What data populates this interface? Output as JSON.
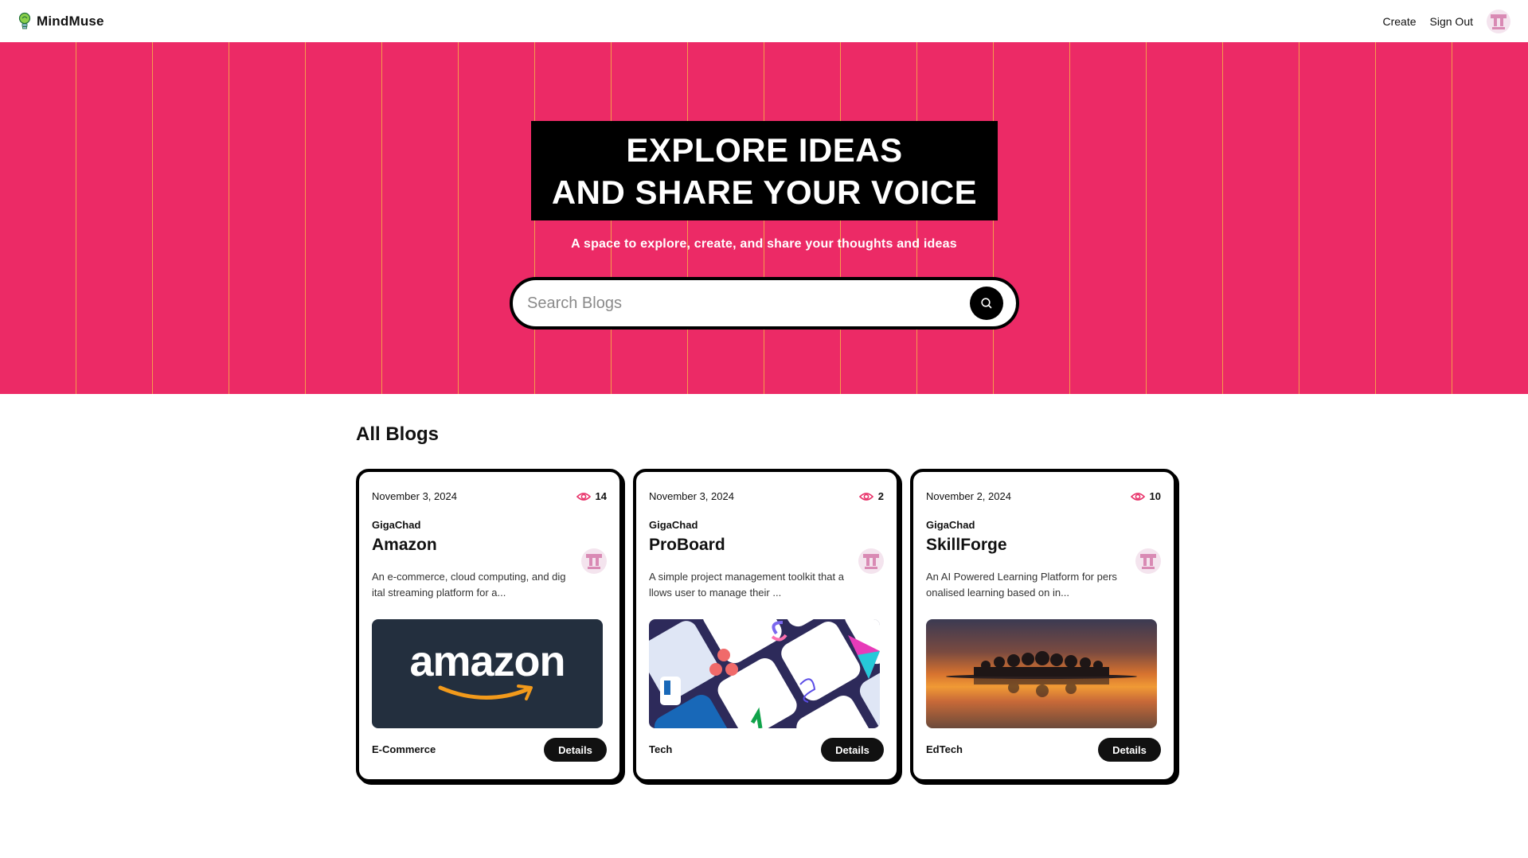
{
  "nav": {
    "brand": "MindMuse",
    "create_label": "Create",
    "signout_label": "Sign Out"
  },
  "hero": {
    "title_line1": "EXPLORE IDEAS",
    "title_line2": "AND SHARE YOUR VOICE",
    "subtitle": "A space to explore, create, and share your thoughts and ideas",
    "search_placeholder": "Search Blogs",
    "search_value": ""
  },
  "section": {
    "title": "All Blogs"
  },
  "colors": {
    "hero_bg": "#ec2a66",
    "hero_stripe": "#f59b4c",
    "accent_eye": "#e8336a",
    "avatar_pink": "#d98ab4"
  },
  "blogs": [
    {
      "date": "November 3, 2024",
      "views": "14",
      "author": "GigaChad",
      "title": "Amazon",
      "description": "An e-commerce, cloud computing, and digital streaming platform for a...",
      "image_text": "amazon",
      "category": "E-Commerce",
      "details_label": "Details"
    },
    {
      "date": "November 3, 2024",
      "views": "2",
      "author": "GigaChad",
      "title": "ProBoard",
      "description": "A simple project management toolkit that allows user to manage their ...",
      "category": "Tech",
      "details_label": "Details"
    },
    {
      "date": "November 2, 2024",
      "views": "10",
      "author": "GigaChad",
      "title": "SkillForge",
      "description": "An AI Powered Learning Platform for personalised learning based on in...",
      "category": "EdTech",
      "details_label": "Details"
    }
  ]
}
